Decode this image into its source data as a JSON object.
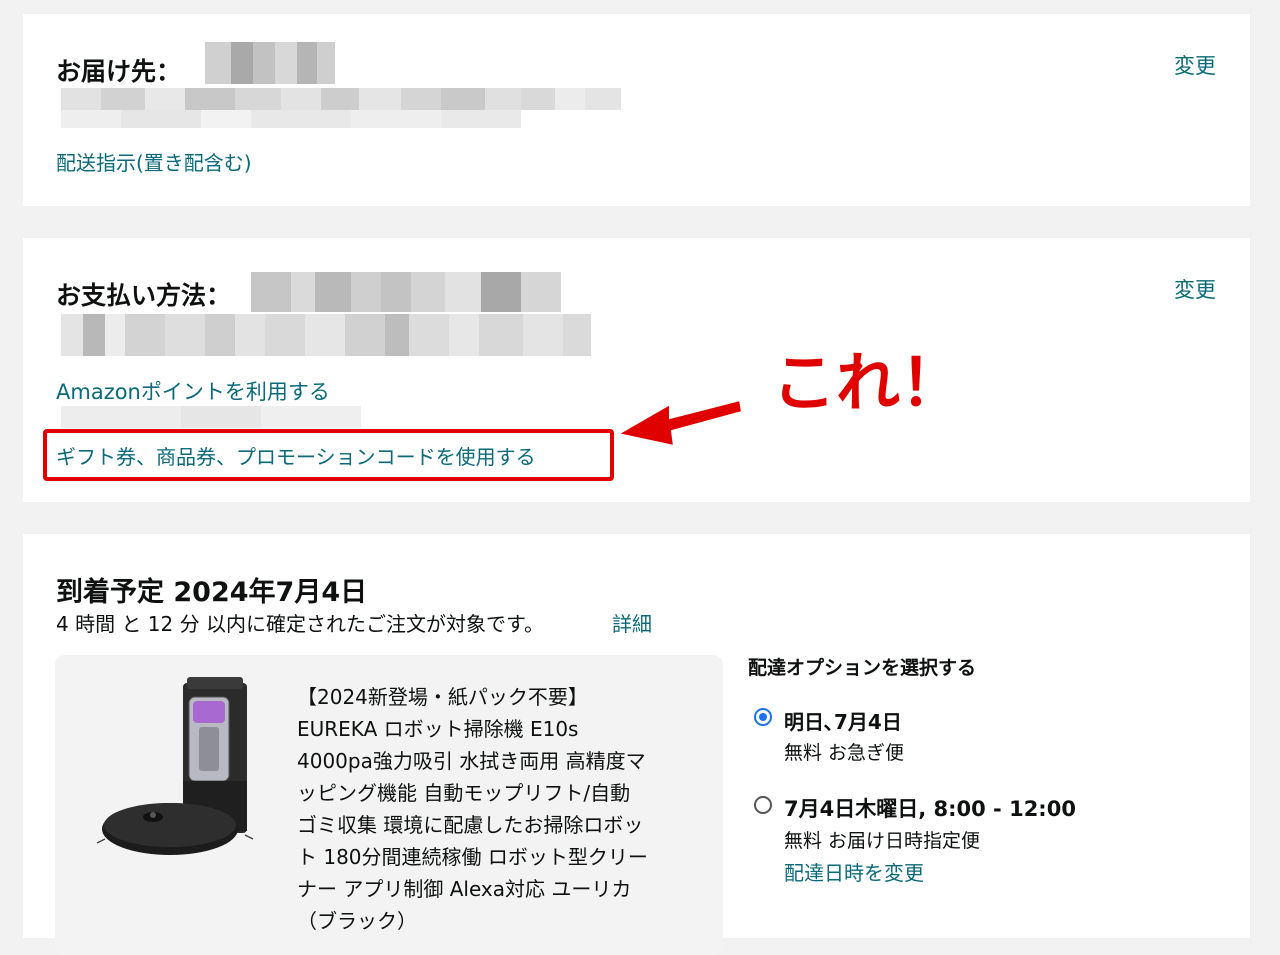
{
  "shipping": {
    "label": "お届け先：",
    "change": "変更",
    "delivery_instructions": "配送指示(置き配含む)"
  },
  "payment": {
    "label": "お支払い方法：",
    "change": "変更",
    "use_points": "Amazonポイントを利用する",
    "gift_card": "ギフト券、商品券、プロモーションコードを使用する"
  },
  "annotation": {
    "callout": "これ！",
    "highlight_color": "#e00000"
  },
  "delivery": {
    "title": "到着予定 2024年7月4日",
    "subtitle": "4 時間 と 12 分 以内に確定されたご注文が対象です。",
    "details_link": "詳細",
    "product_image_icon": "robot-vacuum-with-dock",
    "product_lines": [
      "【2024新登場・紙パック不要】",
      "EUREKA ロボット掃除機 E10s",
      "4000pa強力吸引 水拭き両用 高精度マ",
      "ッピング機能 自動モップリフト/自動",
      "ゴミ収集 環境に配慮したお掃除ロボッ",
      "ト 180分間連続稼働 ロボット型クリー",
      "ナー アプリ制御 Alexa対応 ユーリカ",
      "（ブラック）"
    ],
    "options_title": "配達オプションを選択する",
    "options": [
      {
        "title": "明日､7月4日",
        "detail": "無料 お急ぎ便",
        "selected": true
      },
      {
        "title": "7月4日木曜日, 8:00 - 12:00",
        "detail": "無料 お届け日時指定便",
        "change_link": "配達日時を変更",
        "selected": false
      }
    ]
  },
  "colors": {
    "link": "#0a6a7a",
    "radio_selected": "#1a73e8",
    "background": "#f2f2f2"
  }
}
